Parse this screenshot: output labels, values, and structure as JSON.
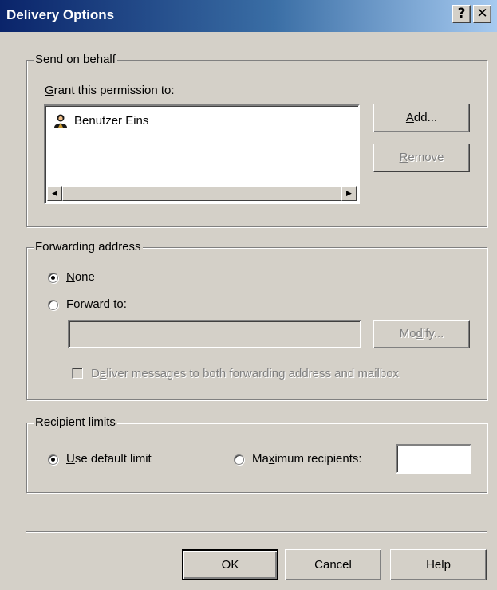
{
  "window": {
    "title": "Delivery Options",
    "help_glyph": "?",
    "close_glyph": "✕"
  },
  "send_on_behalf": {
    "legend": "Send on behalf",
    "grant_label_key": "G",
    "grant_label_rest": "rant this permission to:",
    "list": [
      {
        "name": "Benutzer Eins",
        "icon": "user-icon"
      }
    ],
    "add_key": "A",
    "add_rest": "dd...",
    "remove_key": "R",
    "remove_rest": "emove"
  },
  "forwarding": {
    "legend": "Forwarding address",
    "none_key": "N",
    "none_rest": "one",
    "none_selected": true,
    "forward_key": "F",
    "forward_rest": "orward to:",
    "forward_selected": false,
    "address_value": "",
    "modify_pre": "Mo",
    "modify_key": "d",
    "modify_post": "ify...",
    "deliver_pre": "D",
    "deliver_key": "e",
    "deliver_post": "liver messages to both forwarding address and mailbox",
    "deliver_checked": false
  },
  "recipient_limits": {
    "legend": "Recipient limits",
    "default_key": "U",
    "default_rest": "se default limit",
    "default_selected": true,
    "max_pre": "Ma",
    "max_key": "x",
    "max_post": "imum recipients:",
    "max_selected": false,
    "max_value": ""
  },
  "footer": {
    "ok": "OK",
    "cancel": "Cancel",
    "help": "Help"
  }
}
